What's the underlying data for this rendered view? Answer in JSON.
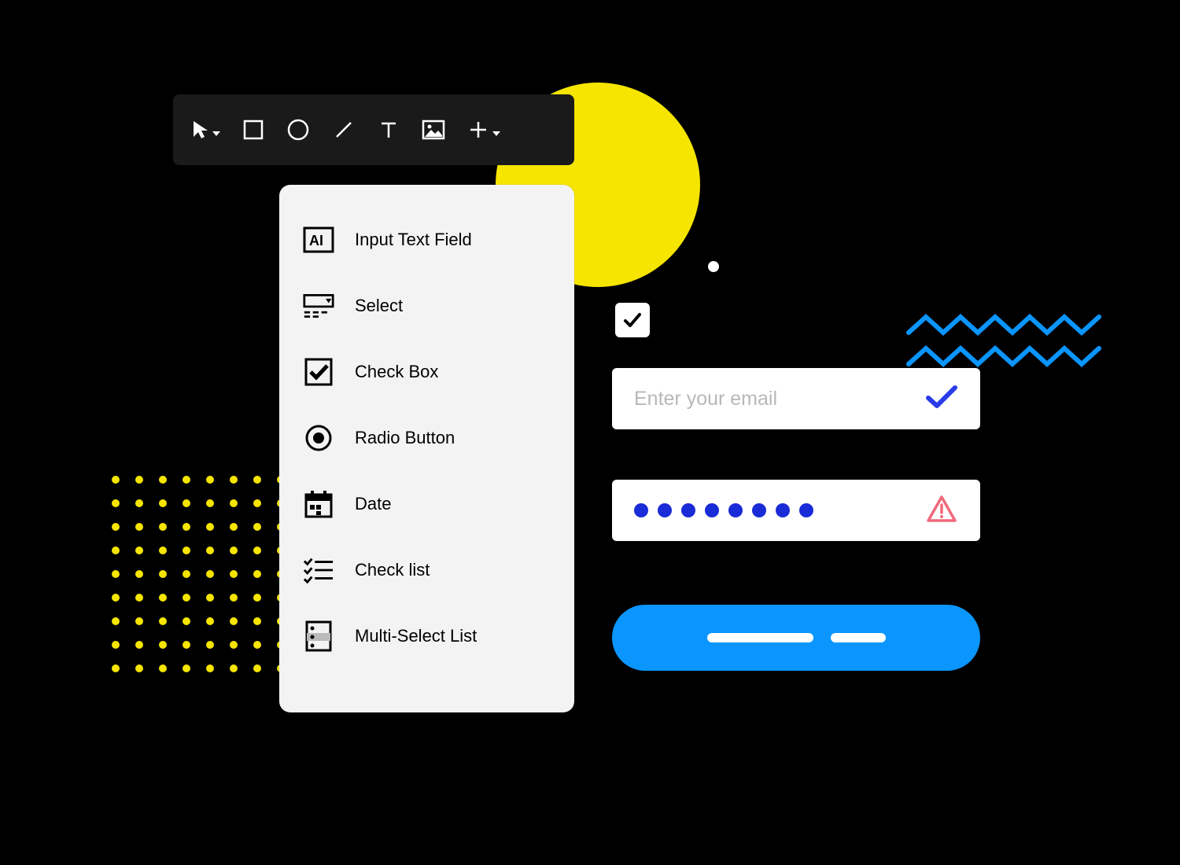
{
  "toolbar": {
    "tools": [
      {
        "name": "pointer",
        "has_dropdown": true
      },
      {
        "name": "rectangle",
        "has_dropdown": false
      },
      {
        "name": "circle",
        "has_dropdown": false
      },
      {
        "name": "line",
        "has_dropdown": false
      },
      {
        "name": "text",
        "has_dropdown": false
      },
      {
        "name": "image",
        "has_dropdown": false
      },
      {
        "name": "plus",
        "has_dropdown": true
      }
    ]
  },
  "component_menu": {
    "items": [
      {
        "icon": "text-field-icon",
        "label": "Input Text Field"
      },
      {
        "icon": "select-icon",
        "label": "Select"
      },
      {
        "icon": "checkbox-icon",
        "label": "Check Box"
      },
      {
        "icon": "radio-icon",
        "label": "Radio Button"
      },
      {
        "icon": "date-icon",
        "label": "Date"
      },
      {
        "icon": "checklist-icon",
        "label": "Check list"
      },
      {
        "icon": "multiselect-icon",
        "label": "Multi-Select List"
      }
    ]
  },
  "email_input": {
    "placeholder": "Enter your email"
  },
  "password_input": {
    "dot_count": 8
  },
  "standalone_checkbox": {
    "checked": true
  },
  "colors": {
    "yellow": "#f5e500",
    "blue_accent": "#0b95ff",
    "blue_check": "#2a3be8",
    "warning_red": "#f0697a",
    "dot_blue": "#1a2bd8"
  }
}
